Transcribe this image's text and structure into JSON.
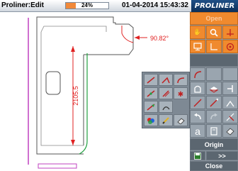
{
  "titlebar": {
    "app_title": "Proliner:Edit",
    "progress_label": "24%",
    "progress_value": 0.24,
    "datetime": "01-04-2014 15:43:32",
    "logo": "PROLINER"
  },
  "drawing": {
    "angle_label": "90.82°",
    "length_label": "2105.5"
  },
  "panel": {
    "open_label": "Open",
    "origin_label": "Origin",
    "more_label": ">>",
    "close_label": "Close",
    "text_tool_label": "a"
  },
  "colors": {
    "accent": "#f08a2e",
    "panel": "#8a959f",
    "dimension": "#e02020",
    "selected_line": "#20a040",
    "shape_line": "#555555",
    "outline": "#c040c0"
  }
}
